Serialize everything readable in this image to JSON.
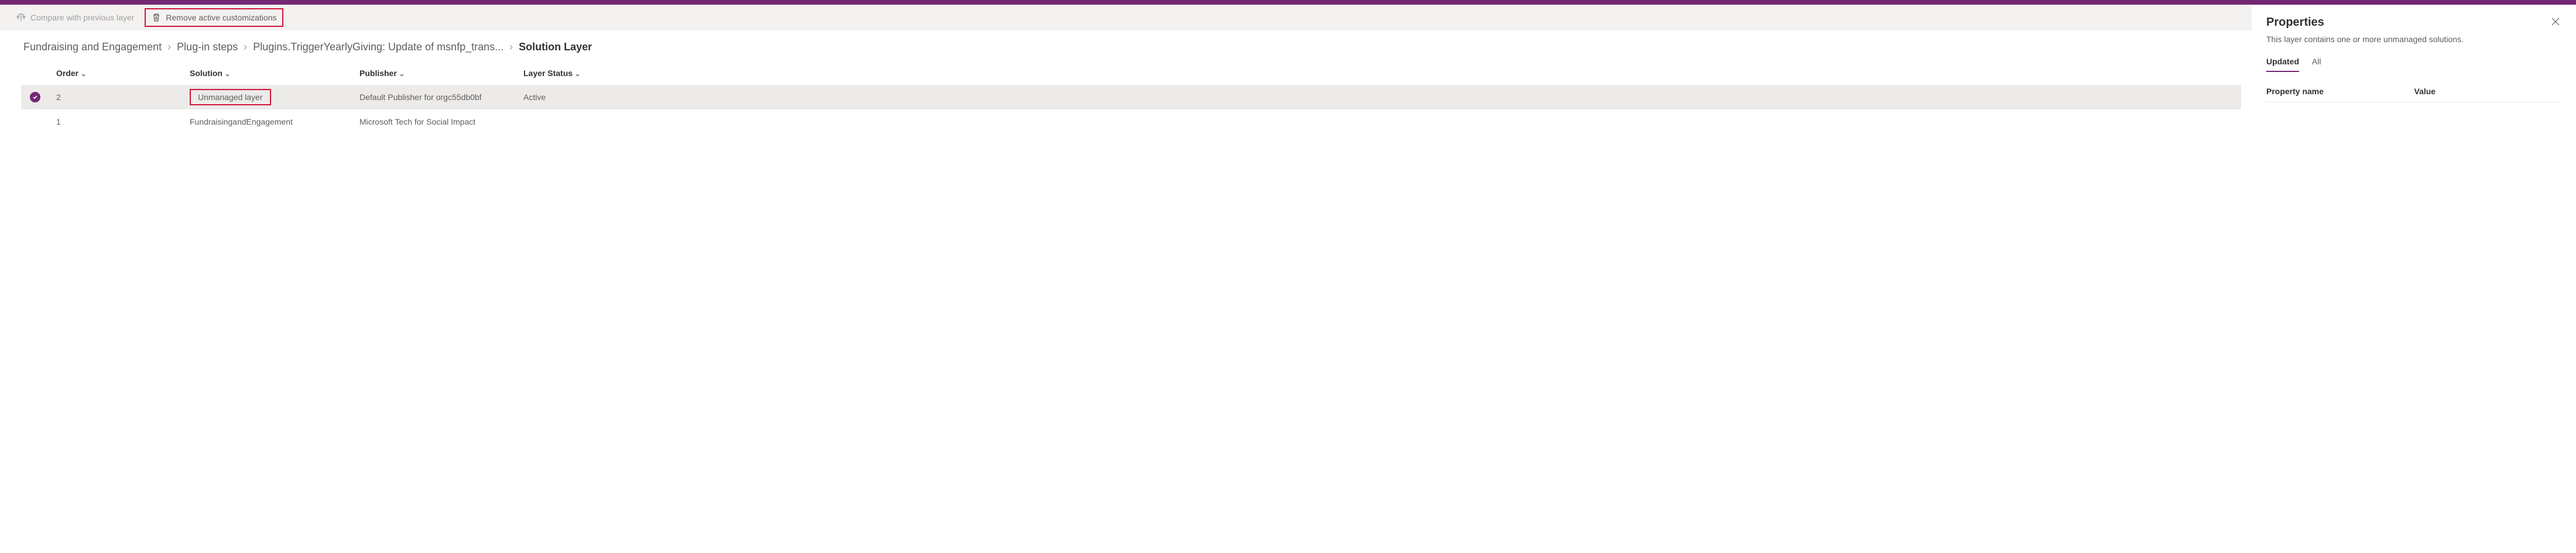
{
  "toolbar": {
    "compare_label": "Compare with previous layer",
    "remove_label": "Remove active customizations"
  },
  "breadcrumb": {
    "items": [
      "Fundraising and Engagement",
      "Plug-in steps",
      "Plugins.TriggerYearlyGiving: Update of msnfp_trans..."
    ],
    "current": "Solution Layer"
  },
  "table": {
    "headers": {
      "order": "Order",
      "solution": "Solution",
      "publisher": "Publisher",
      "status": "Layer Status"
    },
    "rows": [
      {
        "selected": true,
        "order": "2",
        "solution": "Unmanaged layer",
        "publisher": "Default Publisher for orgc55db0bf",
        "status": "Active"
      },
      {
        "selected": false,
        "order": "1",
        "solution": "FundraisingandEngagement",
        "publisher": "Microsoft Tech for Social Impact",
        "status": ""
      }
    ]
  },
  "panel": {
    "title": "Properties",
    "subtitle": "This layer contains one or more unmanaged solutions.",
    "tabs": {
      "updated": "Updated",
      "all": "All"
    },
    "prop_headers": {
      "name": "Property name",
      "value": "Value"
    }
  }
}
